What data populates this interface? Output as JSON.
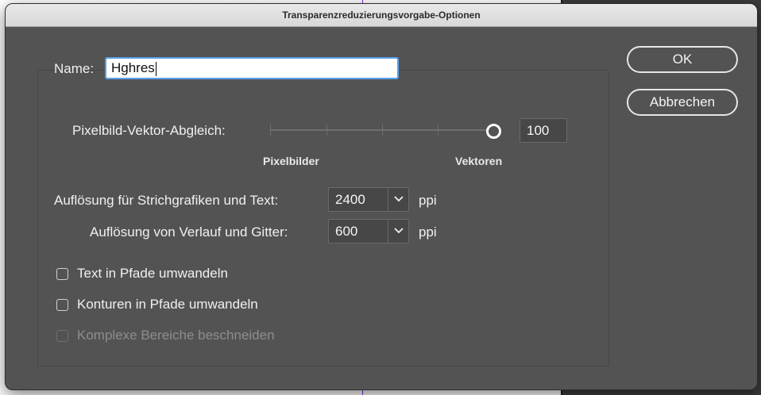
{
  "dialog": {
    "title": "Transparenzreduzierungsvorgabe-Optionen"
  },
  "name_field": {
    "label": "Name:",
    "value": "Hghres"
  },
  "slider": {
    "label": "Pixelbild-Vektor-Abgleich:",
    "value": "100",
    "level_percent": 100,
    "left_label": "Pixelbilder",
    "right_label": "Vektoren"
  },
  "line_art_resolution": {
    "label": "Auflösung für Strichgrafiken und Text:",
    "value": "2400",
    "unit": "ppi"
  },
  "gradient_resolution": {
    "label": "Auflösung von Verlauf und Gitter:",
    "value": "600",
    "unit": "ppi"
  },
  "checkboxes": [
    {
      "label": "Text in Pfade umwandeln",
      "checked": false,
      "enabled": true
    },
    {
      "label": "Konturen in Pfade umwandeln",
      "checked": false,
      "enabled": true
    },
    {
      "label": "Komplexe Bereiche beschneiden",
      "checked": false,
      "enabled": false
    }
  ],
  "buttons": {
    "ok": "OK",
    "cancel": "Abbrechen"
  },
  "colors": {
    "dialog_bg": "#535353",
    "focus": "#5aa0e8",
    "background_accent": "#8a2be2"
  },
  "icons": {
    "combo_arrow": "chevron-down-icon"
  }
}
